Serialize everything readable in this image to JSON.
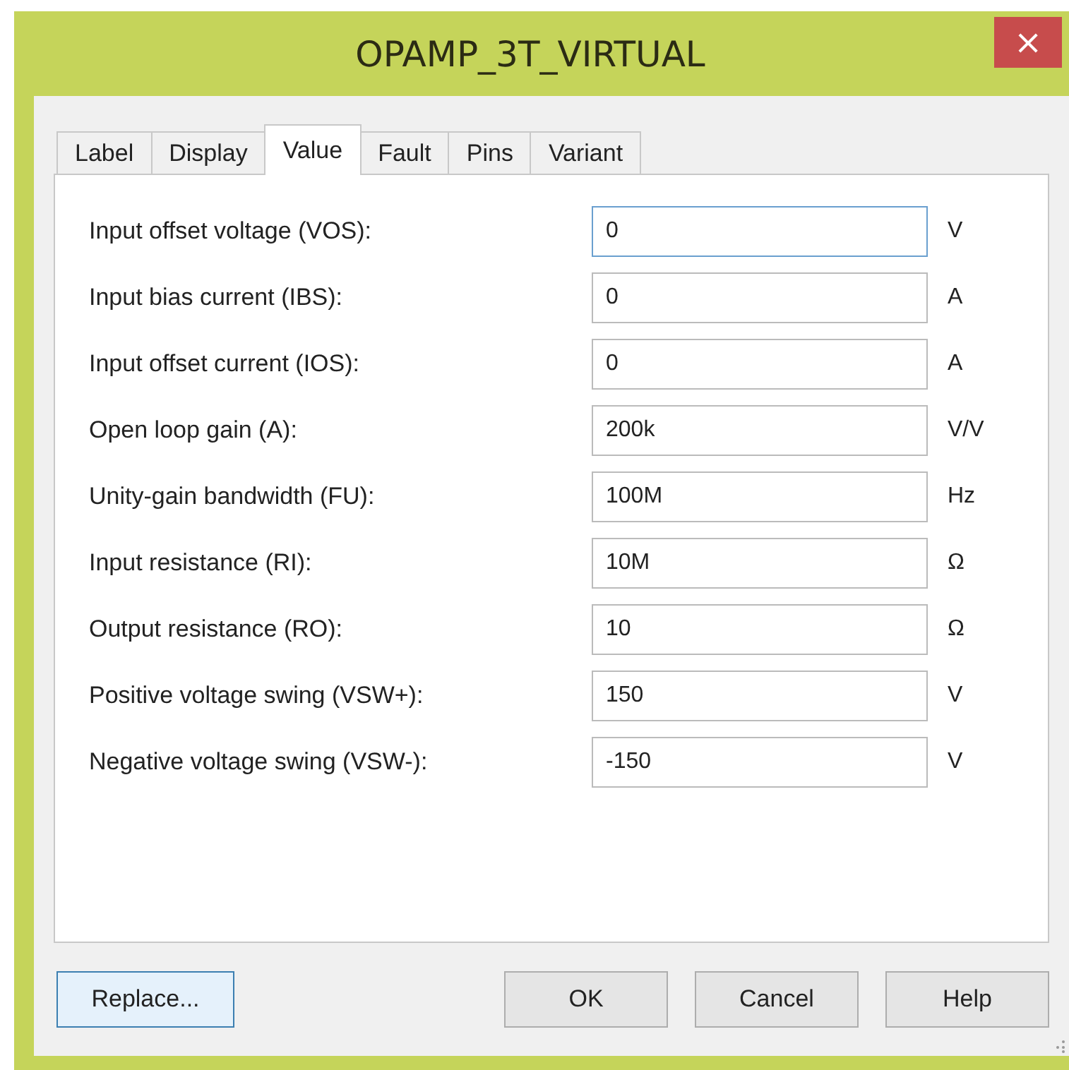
{
  "window": {
    "title": "OPAMP_3T_VIRTUAL",
    "close": "×"
  },
  "tabs": [
    {
      "label": "Label",
      "selected": false
    },
    {
      "label": "Display",
      "selected": false
    },
    {
      "label": "Value",
      "selected": true
    },
    {
      "label": "Fault",
      "selected": false
    },
    {
      "label": "Pins",
      "selected": false
    },
    {
      "label": "Variant",
      "selected": false
    }
  ],
  "fields": [
    {
      "label": "Input offset voltage (VOS):",
      "value": "0",
      "unit": "V",
      "focused": true
    },
    {
      "label": "Input bias current (IBS):",
      "value": "0",
      "unit": "A",
      "focused": false
    },
    {
      "label": "Input offset current (IOS):",
      "value": "0",
      "unit": "A",
      "focused": false
    },
    {
      "label": "Open loop gain (A):",
      "value": "200k",
      "unit": "V/V",
      "focused": false
    },
    {
      "label": "Unity-gain bandwidth (FU):",
      "value": "100M",
      "unit": "Hz",
      "focused": false
    },
    {
      "label": "Input resistance (RI):",
      "value": "10M",
      "unit": "Ω",
      "focused": false
    },
    {
      "label": "Output resistance (RO):",
      "value": "10",
      "unit": "Ω",
      "focused": false
    },
    {
      "label": "Positive voltage swing (VSW+):",
      "value": "150",
      "unit": "V",
      "focused": false
    },
    {
      "label": "Negative voltage swing (VSW-):",
      "value": "-150",
      "unit": "V",
      "focused": false
    }
  ],
  "buttons": [
    {
      "label": "Replace...",
      "focused": true
    },
    {
      "label": "OK",
      "focused": false
    },
    {
      "label": "Cancel",
      "focused": false
    },
    {
      "label": "Help",
      "focused": false
    }
  ]
}
